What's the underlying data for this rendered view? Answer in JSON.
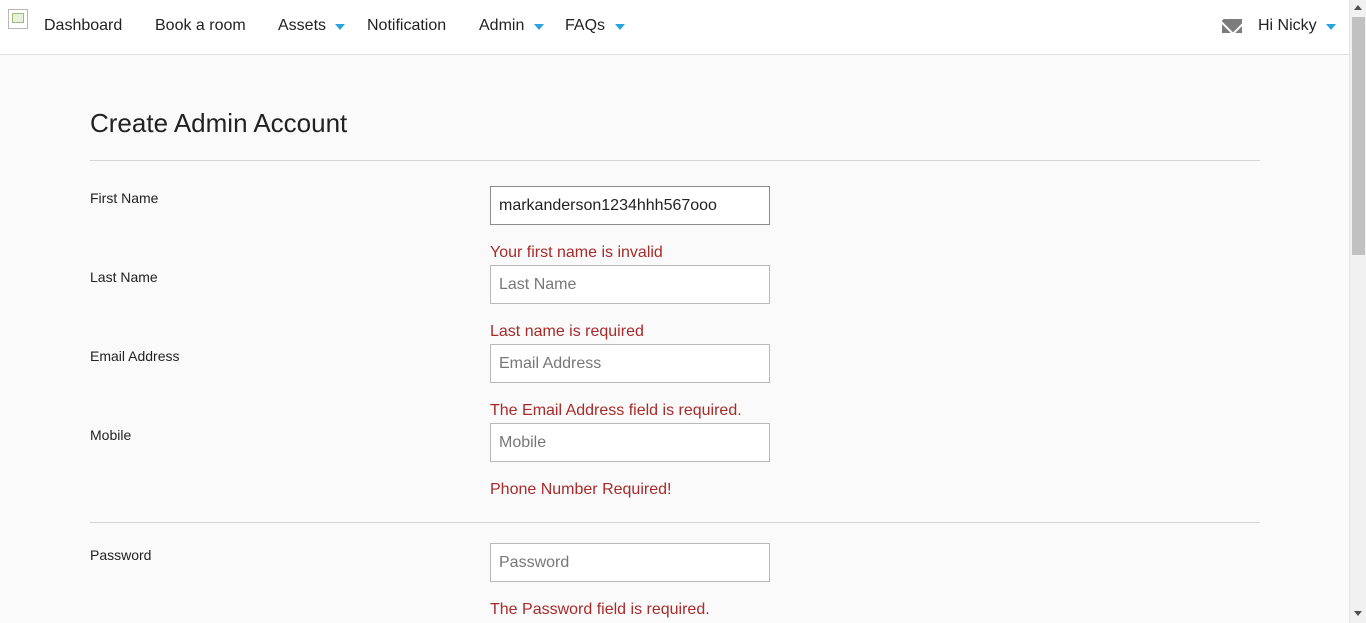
{
  "nav": {
    "items": [
      {
        "label": "Dashboard"
      },
      {
        "label": "Book a room"
      },
      {
        "label": "Assets"
      },
      {
        "label": "Notification"
      },
      {
        "label": "Admin"
      },
      {
        "label": "FAQs"
      }
    ],
    "user_greeting": "Hi Nicky",
    "accent_color": "#2aa4df"
  },
  "page": {
    "title": "Create Admin Account"
  },
  "form": {
    "first_name": {
      "label": "First Name",
      "value": "markanderson1234hhh567ooo",
      "placeholder": "First Name",
      "error": "Your first name is invalid"
    },
    "last_name": {
      "label": "Last Name",
      "value": "",
      "placeholder": "Last Name",
      "error": "Last name is required"
    },
    "email": {
      "label": "Email Address",
      "value": "",
      "placeholder": "Email Address",
      "error": "The Email Address field is required."
    },
    "mobile": {
      "label": "Mobile",
      "value": "",
      "placeholder": "Mobile",
      "error": "Phone Number Required!"
    },
    "password": {
      "label": "Password",
      "value": "",
      "placeholder": "Password",
      "error": "The Password field is required."
    },
    "error_color": "#a82a2a"
  }
}
